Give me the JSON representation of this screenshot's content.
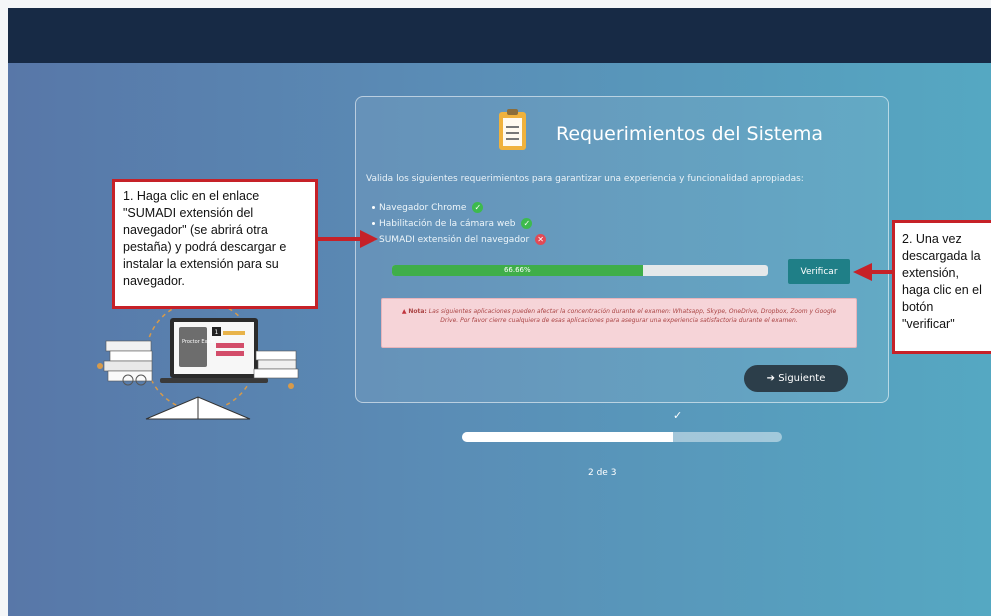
{
  "card": {
    "title": "Requerimientos del Sistema",
    "intro": "Valida los siguientes requerimientos para garantizar una experiencia y funcionalidad apropiadas:",
    "requirements": [
      {
        "label": "Navegador Chrome",
        "status": "ok"
      },
      {
        "label": "Habilitación de la cámara web",
        "status": "ok"
      },
      {
        "label": "SUMADI extensión del navegador",
        "status": "error"
      }
    ],
    "progress": {
      "value": 66.66,
      "label": "66.66%"
    },
    "verify_label": "Verificar",
    "warning_label": "Nota:",
    "warning_text": "Las siguientes aplicaciones pueden afectar la concentración durante el examen: Whatsapp, Skype, OneDrive, Dropbox, Zoom y Google Drive. Por favor cierre cualquiera de esas aplicaciones para asegurar una experiencia satisfactoria durante el examen.",
    "next_label": "Siguiente"
  },
  "steps": {
    "label": "2 de 3",
    "progress": 0.66
  },
  "annotations": {
    "step1": "1. Haga clic en el enlace \"SUMADI extensión del navegador\" (se abrirá otra pestaña) y podrá descargar e instalar la extensión para su navegador.",
    "step2": "2. Una vez descargada la extensión, haga clic en el botón \"verificar\""
  },
  "illustration": {
    "screen_text": "Proctor Exam",
    "badge": "1"
  },
  "colors": {
    "accent": "#1f7f87",
    "success": "#3fae49",
    "error": "#e24a55",
    "annotation": "#c62128",
    "topbar": "#172a45"
  }
}
